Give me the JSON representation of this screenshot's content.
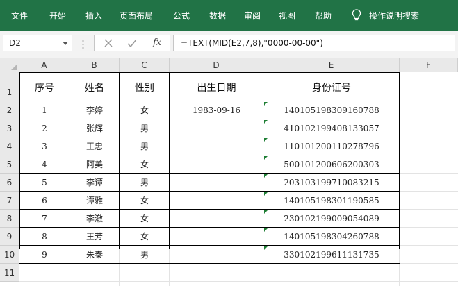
{
  "ribbon": {
    "menu": [
      "文件",
      "开始",
      "插入",
      "页面布局",
      "公式",
      "数据",
      "审阅",
      "视图",
      "帮助"
    ],
    "tell_me": "操作说明搜索",
    "tell_me_icon": "lightbulb-icon",
    "color": "#217346"
  },
  "formula_bar": {
    "name_box": "D2",
    "cancel_icon": "close-icon",
    "enter_icon": "check-icon",
    "fx_label": "fx",
    "formula": "=TEXT(MID(E2,7,8),\"0000-00-00\")"
  },
  "sheet": {
    "columns": [
      "A",
      "B",
      "C",
      "D",
      "E",
      "F"
    ],
    "rows": [
      "1",
      "2",
      "3",
      "4",
      "5",
      "6",
      "7",
      "8",
      "9",
      "10",
      "11"
    ],
    "headers": [
      "序号",
      "姓名",
      "性别",
      "出生日期",
      "身份证号"
    ],
    "data": [
      [
        "1",
        "李婷",
        "女",
        "1983-09-16",
        "140105198309160788"
      ],
      [
        "2",
        "张辉",
        "男",
        "",
        "410102199408133057"
      ],
      [
        "3",
        "王忠",
        "男",
        "",
        "110101200110278796"
      ],
      [
        "4",
        "阿美",
        "女",
        "",
        "500101200606200303"
      ],
      [
        "5",
        "李谭",
        "男",
        "",
        "203103199710083215"
      ],
      [
        "6",
        "谭雅",
        "女",
        "",
        "140105198301190585"
      ],
      [
        "7",
        "李澈",
        "女",
        "",
        "230102199009054089"
      ],
      [
        "8",
        "王芳",
        "女",
        "",
        "140105198304260788"
      ],
      [
        "9",
        "朱秦",
        "男",
        "",
        "330102199611131735"
      ]
    ],
    "text_number_marker_color": "#1e7e34"
  }
}
